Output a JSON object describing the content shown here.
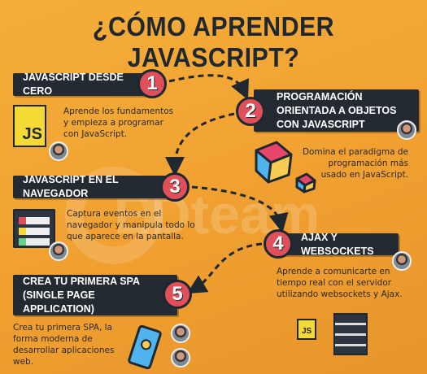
{
  "title": "¿CÓMO APRENDER JAVASCRIPT?",
  "watermark": "EDteam",
  "colors": {
    "background": "#F0A031",
    "box": "#232a31",
    "circle": "#E0505A",
    "js_yellow": "#F5DA35"
  },
  "steps": [
    {
      "number": "1",
      "title": "JAVASCRIPT DESDE CERO",
      "description": "Aprende los fundamentos y empieza a programar con JavaScript.",
      "icon": "js-logo-icon"
    },
    {
      "number": "2",
      "title": "PROGRAMACIÓN ORIENTADA A OBJETOS CON JAVASCRIPT",
      "description": "Domina el paradigma de programación más usado en JavaScript.",
      "icon": "cube-icon"
    },
    {
      "number": "3",
      "title": "JAVASCRIPT EN EL NAVEGADOR",
      "description": "Captura eventos en el navegador y manipula todo lo que aparece en la pantalla.",
      "icon": "browser-icon"
    },
    {
      "number": "4",
      "title": "AJAX Y WEBSOCKETS",
      "description": "Aprende a comunicarte en tiempo real con el servidor utilizando websockets y Ajax.",
      "icon": "server-icon"
    },
    {
      "number": "5",
      "title": "CREA TU PRIMERA SPA (SINGLE PAGE APPLICATION)",
      "description": "Crea tu primera SPA, la forma moderna de desarrollar aplicaciones web.",
      "icon": "phone-icon"
    }
  ],
  "js_label": "JS"
}
